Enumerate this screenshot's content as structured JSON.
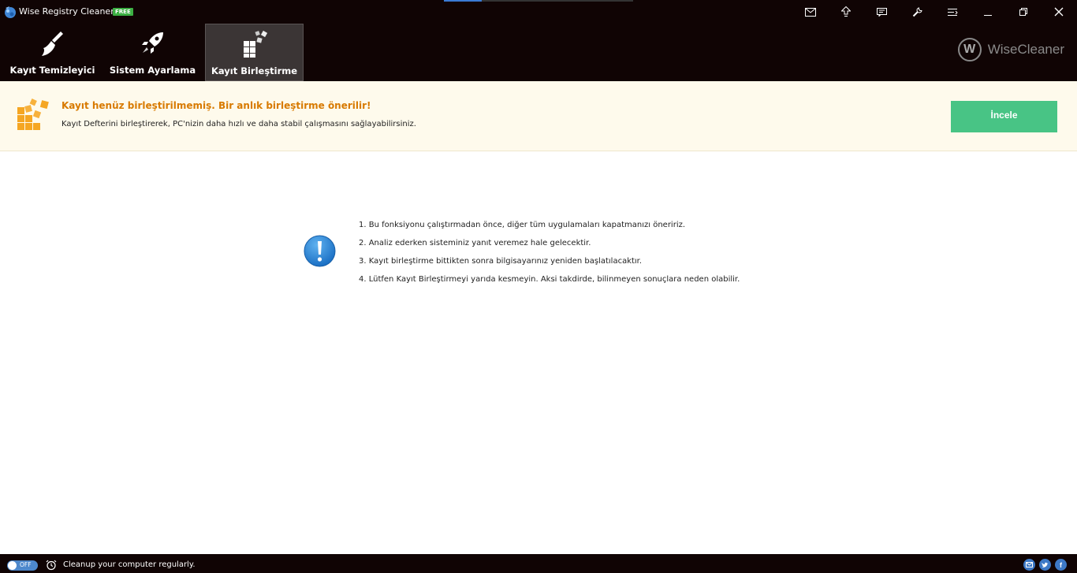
{
  "window": {
    "title": "Wise Registry Cleaner X",
    "badge": "FREE",
    "progress_fraction": 0.2
  },
  "tabs": [
    {
      "label": "Kayıt Temizleyici",
      "icon": "broom-icon",
      "active": false
    },
    {
      "label": "Sistem Ayarlama",
      "icon": "rocket-icon",
      "active": false
    },
    {
      "label": "Kayıt Birleştirme",
      "icon": "defrag-blocks-icon",
      "active": true
    }
  ],
  "brand": {
    "mark": "W",
    "name": "WiseCleaner"
  },
  "banner": {
    "title": "Kayıt henüz birleştirilmemiş. Bir anlık birleştirme önerilir!",
    "description": "Kayıt Defterini birleştirerek, PC'nizin daha hızlı ve daha stabil çalışmasını sağlayabilirsiniz.",
    "button_label": "İncele",
    "accent_color": "#d87a00",
    "button_color": "#48c485"
  },
  "instructions": [
    "1. Bu fonksiyonu çalıştırmadan önce, diğer tüm uygulamaları kapatmanızı öneririz.",
    "2. Analiz ederken sisteminiz yanıt veremez hale gelecektir.",
    "3. Kayıt birleştirme bittikten sonra bilgisayarınız yeniden başlatılacaktır.",
    "4. Lütfen Kayıt Birleştirmeyi yarıda kesmeyin. Aksi takdirde, bilinmeyen sonuçlara neden olabilir."
  ],
  "statusbar": {
    "toggle_label": "OFF",
    "message": "Cleanup your computer regularly.",
    "social": [
      "email-icon",
      "twitter-icon",
      "facebook-icon"
    ],
    "facebook_letter": "f"
  }
}
